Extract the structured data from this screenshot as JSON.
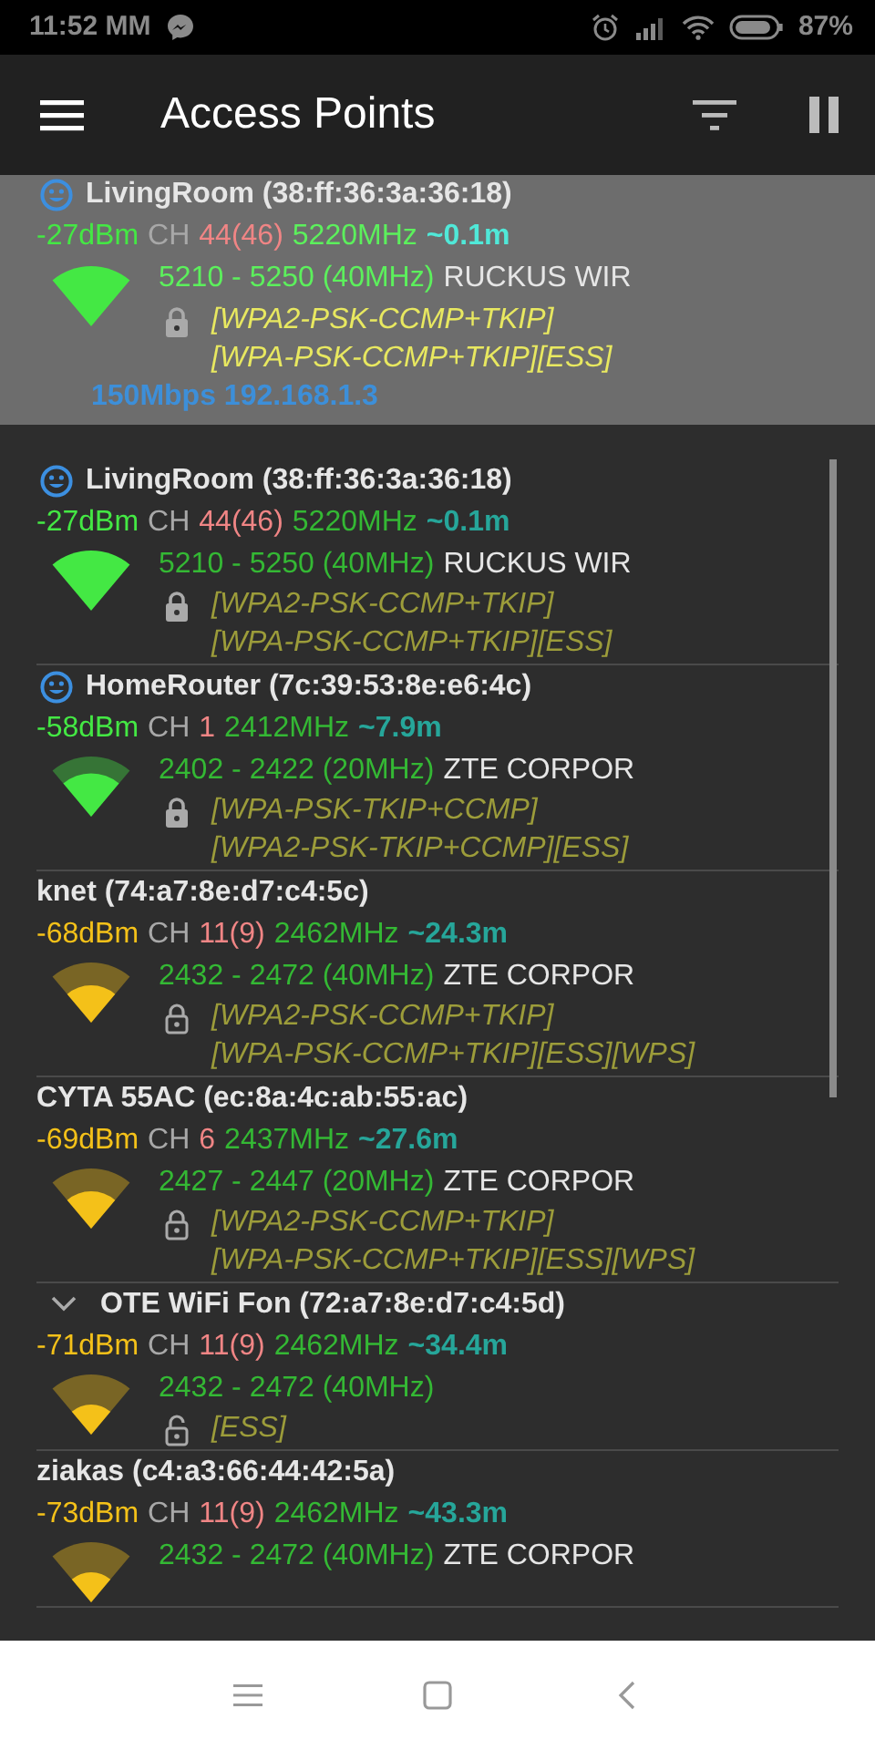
{
  "status_bar": {
    "time": "11:52 MM",
    "battery": "87%"
  },
  "app_bar": {
    "title": "Access Points"
  },
  "connected": {
    "title": "LivingRoom (38:ff:36:3a:36:18)",
    "saved": true,
    "expanded": false,
    "kind": "excellent",
    "color": "#44e844",
    "dbm": "-27dBm",
    "ch_label": "CH",
    "channel": "44(46)",
    "freq": "5220MHz",
    "distance": "~0.1m",
    "range": "5210 - 5250 (40MHz)",
    "vendor": "RUCKUS WIR",
    "secured": true,
    "security": [
      "[WPA2-PSK-CCMP+TKIP]",
      "[WPA-PSK-CCMP+TKIP][ESS]"
    ],
    "link": "150Mbps 192.168.1.3"
  },
  "access_points": [
    {
      "title": "LivingRoom (38:ff:36:3a:36:18)",
      "saved": true,
      "expanded": false,
      "kind": "excellent",
      "color": "#44e844",
      "dbm": "-27dBm",
      "ch_label": "CH",
      "channel": "44(46)",
      "freq": "5220MHz",
      "distance": "~0.1m",
      "range": "5210 - 5250 (40MHz)",
      "vendor": "RUCKUS WIR",
      "secured": true,
      "security": [
        "[WPA2-PSK-CCMP+TKIP]",
        "[WPA-PSK-CCMP+TKIP][ESS]"
      ]
    },
    {
      "title": "HomeRouter (7c:39:53:8e:e6:4c)",
      "saved": true,
      "expanded": false,
      "kind": "good",
      "color": "#44e844",
      "dbm": "-58dBm",
      "ch_label": "CH",
      "channel": "1",
      "freq": "2412MHz",
      "distance": "~7.9m",
      "range": "2402 - 2422 (20MHz)",
      "vendor": "ZTE CORPOR",
      "secured": true,
      "security": [
        "[WPA-PSK-TKIP+CCMP]",
        "[WPA2-PSK-TKIP+CCMP][ESS]"
      ]
    },
    {
      "title": "knet (74:a7:8e:d7:c4:5c)",
      "saved": false,
      "expanded": false,
      "kind": "fair",
      "color": "#f4c119",
      "dbm": "-68dBm",
      "ch_label": "CH",
      "channel": "11(9)",
      "freq": "2462MHz",
      "distance": "~24.3m",
      "range": "2432 - 2472 (40MHz)",
      "vendor": "ZTE CORPOR",
      "secured": true,
      "security": [
        "[WPA2-PSK-CCMP+TKIP]",
        "[WPA-PSK-CCMP+TKIP][ESS][WPS]"
      ]
    },
    {
      "title": "CYTA 55AC (ec:8a:4c:ab:55:ac)",
      "saved": false,
      "expanded": false,
      "kind": "fair",
      "color": "#f4c119",
      "dbm": "-69dBm",
      "ch_label": "CH",
      "channel": "6",
      "freq": "2437MHz",
      "distance": "~27.6m",
      "range": "2427 - 2447 (20MHz)",
      "vendor": "ZTE CORPOR",
      "secured": true,
      "security": [
        "[WPA2-PSK-CCMP+TKIP]",
        "[WPA-PSK-CCMP+TKIP][ESS][WPS]"
      ]
    },
    {
      "title": "OTE WiFi Fon (72:a7:8e:d7:c4:5d)",
      "saved": false,
      "expanded": true,
      "kind": "weak",
      "color": "#f4c119",
      "dbm": "-71dBm",
      "ch_label": "CH",
      "channel": "11(9)",
      "freq": "2462MHz",
      "distance": "~34.4m",
      "range": "2432 - 2472 (40MHz)",
      "secured": false,
      "security": [
        "[ESS]"
      ]
    },
    {
      "title": "ziakas (c4:a3:66:44:42:5a)",
      "saved": false,
      "expanded": false,
      "kind": "weak",
      "color": "#f4c119",
      "dbm": "-73dBm",
      "ch_label": "CH",
      "channel": "11(9)",
      "freq": "2462MHz",
      "distance": "~43.3m",
      "range": "2432 - 2472 (40MHz)",
      "vendor": "ZTE CORPOR"
    }
  ]
}
